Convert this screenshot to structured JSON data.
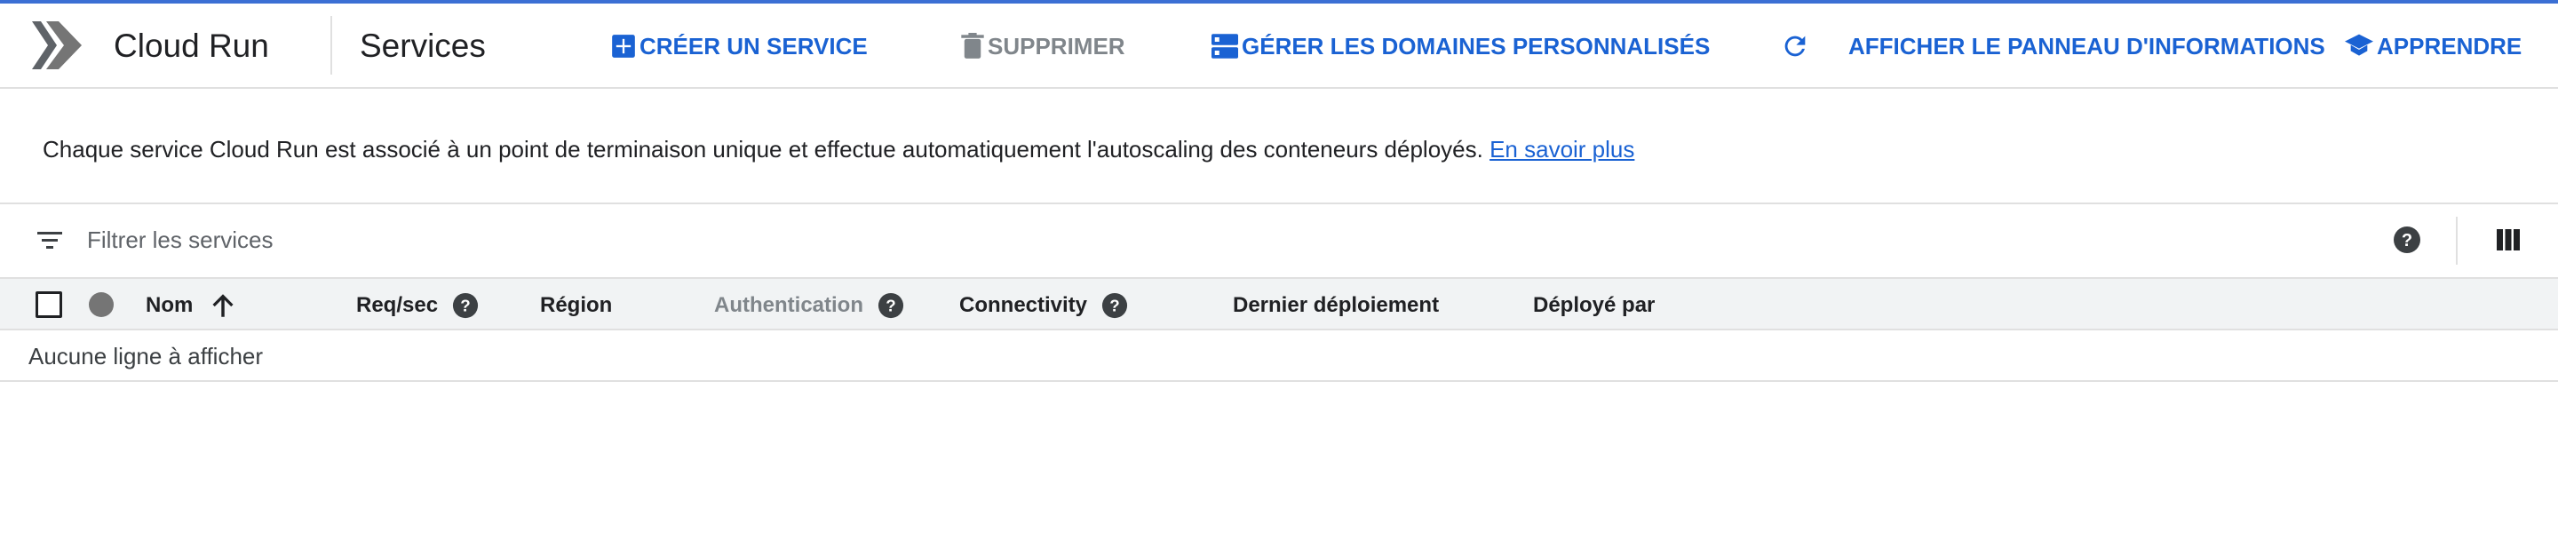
{
  "header": {
    "app_title": "Cloud Run",
    "page_title": "Services",
    "actions": {
      "create": "CRÉER UN SERVICE",
      "delete": "SUPPRIMER",
      "domains": "GÉRER LES DOMAINES PERSONNALISÉS",
      "info_panel": "AFFICHER LE PANNEAU D'INFORMATIONS",
      "learn": "APPRENDRE"
    }
  },
  "info": {
    "text": "Chaque service Cloud Run est associé à un point de terminaison unique et effectue automatiquement l'autoscaling des conteneurs déployés.",
    "link": "En savoir plus"
  },
  "filter": {
    "placeholder": "Filtrer les services"
  },
  "table": {
    "columns": {
      "name": "Nom",
      "req": "Req/sec",
      "region": "Région",
      "auth": "Authentication",
      "connectivity": "Connectivity",
      "last_deploy": "Dernier déploiement",
      "deployed_by": "Déployé par"
    },
    "empty": "Aucune ligne à afficher"
  },
  "colors": {
    "accent": "#1a62d3",
    "disabled": "#80868b",
    "top_bar": "#3b6fd4"
  }
}
